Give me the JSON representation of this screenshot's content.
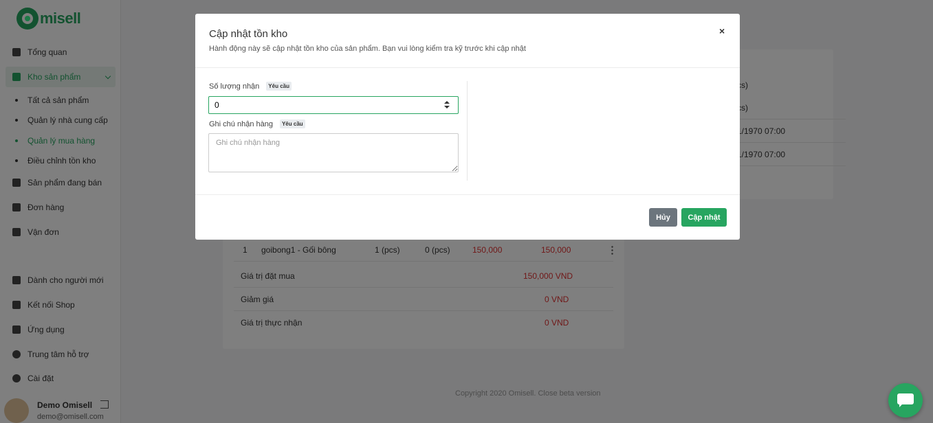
{
  "sidebar": {
    "logo_text": "misell",
    "items": [
      {
        "label": "Tổng quan",
        "icon": "home-icon"
      },
      {
        "label": "Kho sản phẩm",
        "icon": "box-icon"
      },
      {
        "label": "Sản phẩm đang bán",
        "icon": "bag-icon"
      },
      {
        "label": "Đơn hàng",
        "icon": "orders-icon"
      },
      {
        "label": "Vận đơn",
        "icon": "truck-icon"
      },
      {
        "label": "Dành cho người mới",
        "icon": "book-icon"
      },
      {
        "label": "Kết nối Shop",
        "icon": "cart-icon"
      },
      {
        "label": "Ứng dụng",
        "icon": "apps-icon"
      },
      {
        "label": "Trung tâm hỗ trợ",
        "icon": "help-icon"
      },
      {
        "label": "Cài đặt",
        "icon": "gear-icon"
      }
    ],
    "sub_items": [
      {
        "label": "Tất cả sản phẩm"
      },
      {
        "label": "Quản lý nhà cung cấp"
      },
      {
        "label": "Quản lý mua hàng"
      },
      {
        "label": "Điều chỉnh tồn kho"
      }
    ],
    "user": {
      "name": "Demo Omisell",
      "email": "demo@omisell.com"
    }
  },
  "background": {
    "right_card_rows": [
      "cs)",
      "cs)",
      "1/1970 07:00",
      "1/1970 07:00"
    ],
    "table": {
      "row": {
        "index": "1",
        "product": "goibong1 - Gối bông",
        "qty_ordered": "1 (pcs)",
        "qty_received": "0 (pcs)",
        "unit_price": "150,000",
        "total": "150,000"
      },
      "summary": [
        {
          "label": "Giá trị đặt mua",
          "value": "150,000 VND"
        },
        {
          "label": "Giảm giá",
          "value": "0 VND"
        },
        {
          "label": "Giá trị thực nhận",
          "value": "0 VND"
        }
      ]
    },
    "copyright": "Copyright 2020 Omisell. Close beta version"
  },
  "modal": {
    "title": "Cập nhật tồn kho",
    "subtitle": "Hành động này sẽ cập nhật tồn kho của sản phẩm. Bạn vui lòng kiểm tra kỹ trước khi cập nhật",
    "close_label": "×",
    "fields": {
      "quantity": {
        "label": "Số lượng nhận",
        "badge": "Yêu cầu",
        "value": "0"
      },
      "note": {
        "label": "Ghi chú nhận hàng",
        "badge": "Yêu cầu",
        "placeholder": "Ghi chú nhận hàng"
      }
    },
    "buttons": {
      "cancel": "Hủy",
      "update": "Cập nhật"
    }
  },
  "colors": {
    "accent": "#27a560",
    "danger": "#e03131",
    "secondary": "#6c757d"
  }
}
